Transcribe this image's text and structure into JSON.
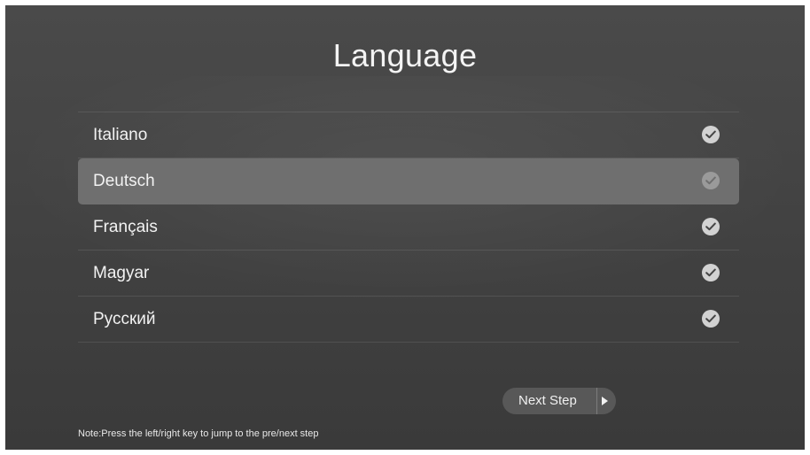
{
  "title": "Language",
  "languages": [
    {
      "label": "Italiano",
      "selected": false,
      "checked": true
    },
    {
      "label": "Deutsch",
      "selected": true,
      "checked": true
    },
    {
      "label": "Français",
      "selected": false,
      "checked": true
    },
    {
      "label": "Magyar",
      "selected": false,
      "checked": true
    },
    {
      "label": "Русский",
      "selected": false,
      "checked": true
    }
  ],
  "next_button": {
    "label": "Next Step",
    "icon": "play-arrow-icon"
  },
  "note": "Note:Press the left/right key to jump to the pre/next step",
  "icons": {
    "check": "check-circle-icon"
  },
  "colors": {
    "background": "#424242",
    "highlight": "#6f6f6f",
    "text": "#f2f2f2",
    "check": "#d2d2d2",
    "button": "#585858"
  }
}
